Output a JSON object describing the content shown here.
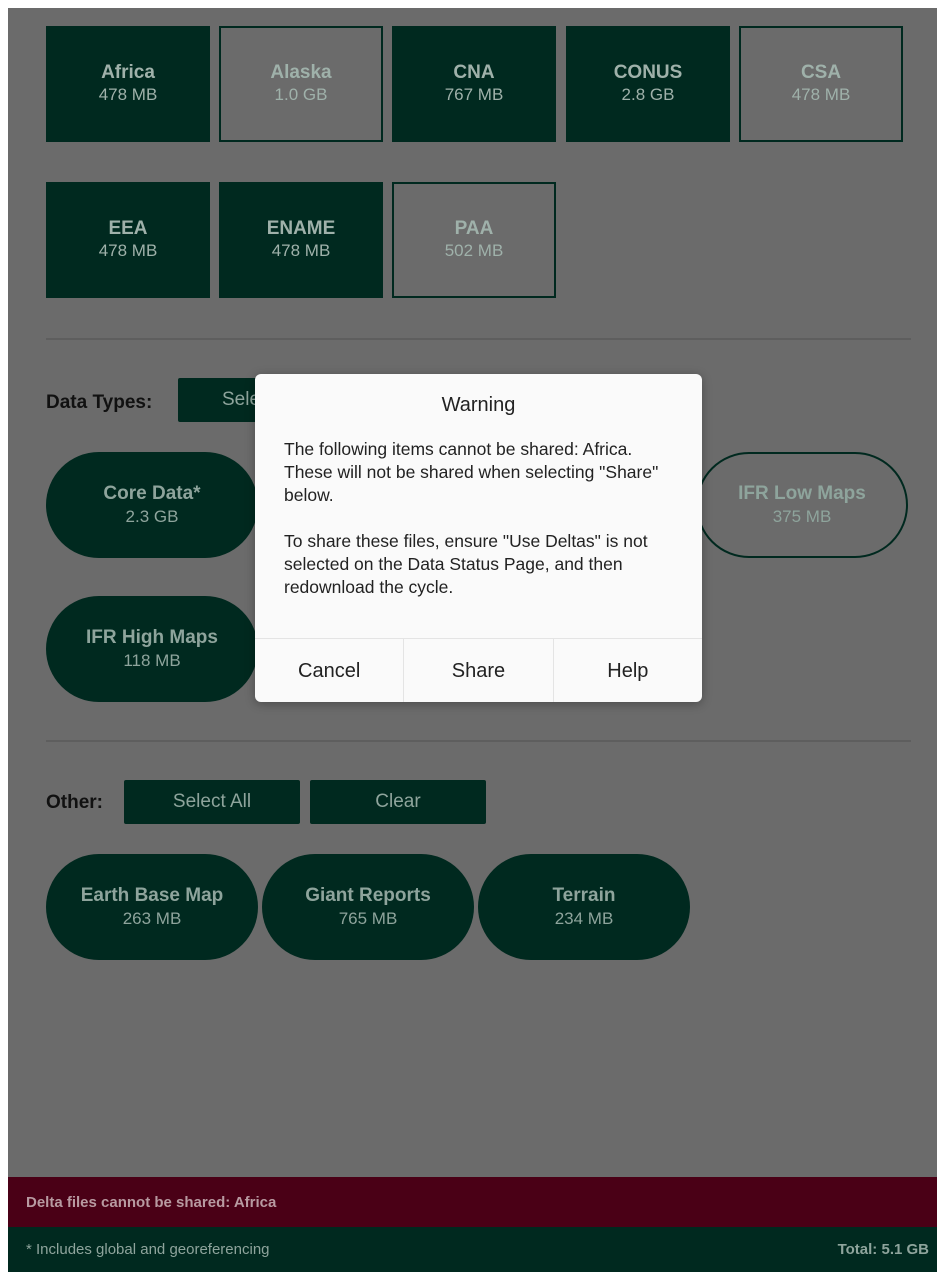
{
  "regions": [
    {
      "name": "Africa",
      "size": "478 MB",
      "selected": true
    },
    {
      "name": "Alaska",
      "size": "1.0 GB",
      "selected": false
    },
    {
      "name": "CNA",
      "size": "767 MB",
      "selected": true
    },
    {
      "name": "CONUS",
      "size": "2.8 GB",
      "selected": true
    },
    {
      "name": "CSA",
      "size": "478 MB",
      "selected": false
    },
    {
      "name": "EEA",
      "size": "478 MB",
      "selected": true
    },
    {
      "name": "ENAME",
      "size": "478 MB",
      "selected": true
    },
    {
      "name": "PAA",
      "size": "502 MB",
      "selected": false
    }
  ],
  "data_types": {
    "label": "Data Types:",
    "select_all_partial": "Sele",
    "items": [
      {
        "name": "Core Data*",
        "size": "2.3 GB",
        "selected": true
      },
      {
        "name": "IFR Low Maps",
        "size": "375 MB",
        "selected": false
      },
      {
        "name": "IFR High Maps",
        "size": "118 MB",
        "selected": true
      }
    ]
  },
  "other": {
    "label": "Other:",
    "select_all": "Select All",
    "clear": "Clear",
    "items": [
      {
        "name": "Earth Base Map",
        "size": "263 MB",
        "selected": true
      },
      {
        "name": "Giant Reports",
        "size": "765 MB",
        "selected": true
      },
      {
        "name": "Terrain",
        "size": "234 MB",
        "selected": true
      }
    ]
  },
  "warning_bar": "Delta files cannot be shared: Africa",
  "footer": {
    "note": "* Includes global and georeferencing",
    "total": "Total: 5.1 GB"
  },
  "dialog": {
    "title": "Warning",
    "message_1": "The following items cannot be shared: Africa. These will not be shared when selecting \"Share\" below.",
    "message_2": "To share these files, ensure \"Use Deltas\" is not selected on the Data Status Page, and then redownload the cycle.",
    "cancel": "Cancel",
    "share": "Share",
    "help": "Help"
  }
}
